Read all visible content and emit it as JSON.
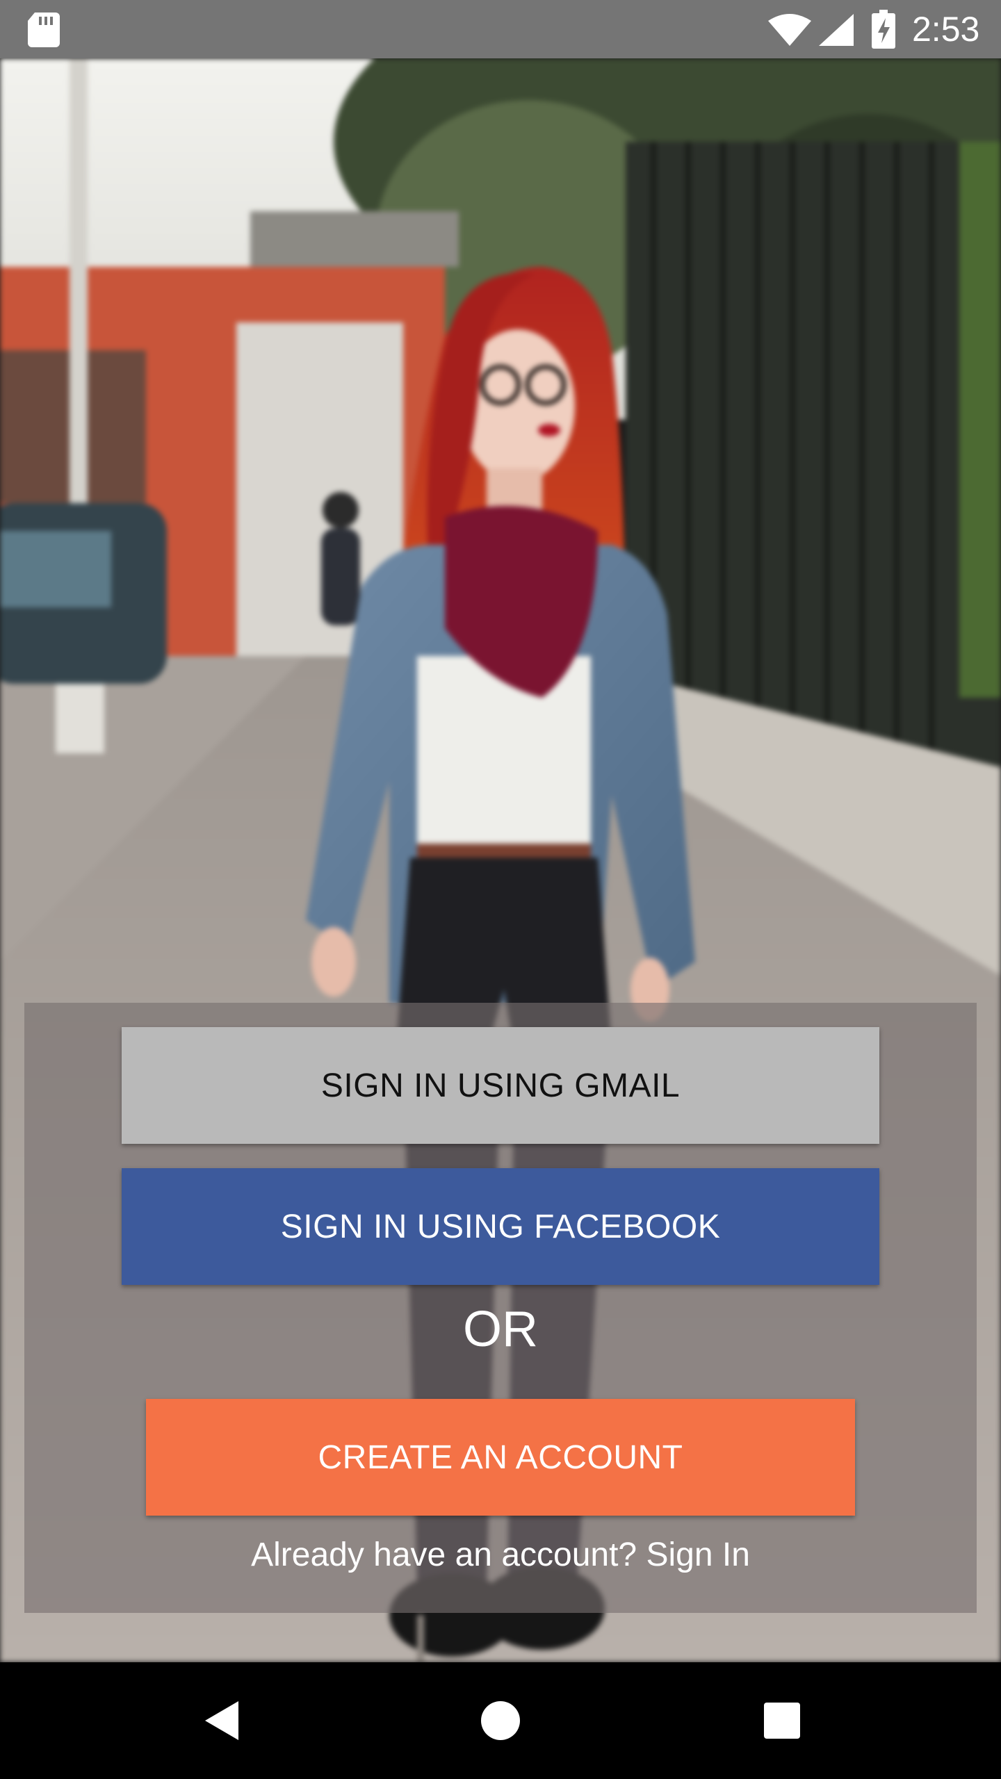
{
  "status_bar": {
    "time": "2:53",
    "icons": [
      "sd-card-icon",
      "wifi-icon",
      "cell-signal-icon",
      "battery-charging-icon"
    ]
  },
  "background": {
    "description_icon": "photo-background"
  },
  "auth_panel": {
    "gmail_button": "SIGN IN USING GMAIL",
    "facebook_button": "SIGN IN USING FACEBOOK",
    "or_label": "OR",
    "create_account_button": "CREATE AN ACCOUNT",
    "sign_in_link": "Already have an account? Sign In"
  },
  "colors": {
    "status_bar": "#757575",
    "gmail_button": "#b9b9b9",
    "facebook_button": "#3d5a9c",
    "create_account_button": "#f47246",
    "nav_bar": "#000000"
  },
  "nav_bar": {
    "icons": [
      "back-icon",
      "home-icon",
      "recents-icon"
    ]
  }
}
